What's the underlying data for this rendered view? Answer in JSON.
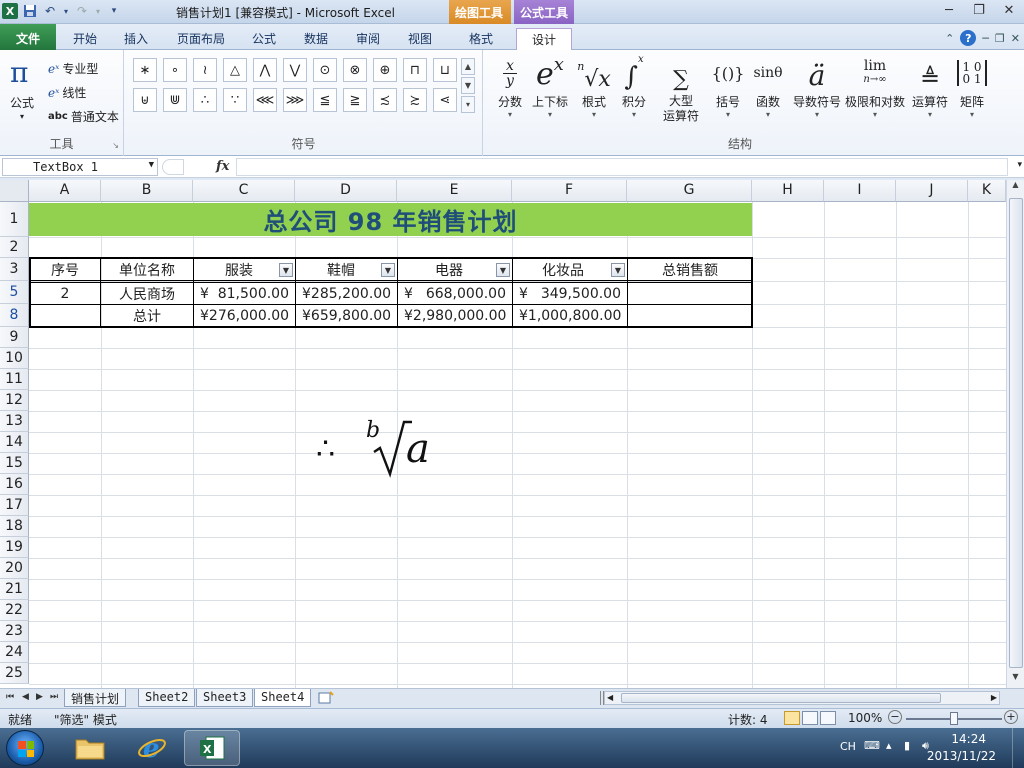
{
  "window": {
    "title": "销售计划1  [兼容模式]  -  Microsoft Excel",
    "context_tab_drawing": "绘图工具",
    "context_tab_equation": "公式工具"
  },
  "tabs": [
    "文件",
    "开始",
    "插入",
    "页面布局",
    "公式",
    "数据",
    "审阅",
    "视图",
    "格式",
    "设计"
  ],
  "active_tab": "设计",
  "ribbon": {
    "tools_group": {
      "equation_label": "公式",
      "professional": "专业型",
      "linear": "线性",
      "normal_text": "普通文本",
      "normal_text_prefix": "abc",
      "group_label": "工具"
    },
    "symbols_group": {
      "row1": [
        "∗",
        "∘",
        "≀",
        "△",
        "⋀",
        "⋁",
        "⊙",
        "⊗",
        "⊕",
        "⊓",
        "⊔"
      ],
      "row2": [
        "⊎",
        "⋓",
        "∴",
        "∵",
        "⋘",
        "⋙",
        "≦",
        "≧",
        "≾",
        "≿",
        "⋖"
      ],
      "group_label": "符号"
    },
    "structures_group": {
      "items": [
        {
          "label": "分数",
          "glyph": "x/y"
        },
        {
          "label": "上下标",
          "glyph": "eˣ"
        },
        {
          "label": "根式",
          "glyph": "ⁿ√x"
        },
        {
          "label": "积分",
          "glyph": "∫"
        },
        {
          "label": "大型\n运算符",
          "glyph": "∑"
        },
        {
          "label": "括号",
          "glyph": "{()}"
        },
        {
          "label": "函数",
          "glyph": "sinθ"
        },
        {
          "label": "导数符号",
          "glyph": "ä"
        },
        {
          "label": "极限和对数",
          "glyph": "lim"
        },
        {
          "label": "运算符",
          "glyph": "≜"
        },
        {
          "label": "矩阵",
          "glyph": "[10 01]"
        }
      ],
      "group_label": "结构"
    }
  },
  "formula_bar": {
    "name_box": "TextBox 1",
    "fx": "fx",
    "value": ""
  },
  "columns": [
    "A",
    "B",
    "C",
    "D",
    "E",
    "F",
    "G",
    "H",
    "I",
    "J",
    "K"
  ],
  "rows": [
    "1",
    "2",
    "3",
    "5",
    "8",
    "9",
    "10",
    "11",
    "12",
    "13",
    "14",
    "15",
    "16",
    "17",
    "18",
    "19",
    "20",
    "21",
    "22",
    "23",
    "24",
    "25"
  ],
  "sheet": {
    "title": "总公司  98  年销售计划",
    "headers": [
      "序号",
      "单位名称",
      "服装",
      "鞋帽",
      "电器",
      "化妆品",
      "总销售额"
    ],
    "row5": {
      "seq": "2",
      "unit": "人民商场",
      "c": "81,500.00",
      "d": "285,200.00",
      "e": "668,000.00",
      "f": "349,500.00",
      "g": ""
    },
    "row8": {
      "seq": "",
      "unit": "总计",
      "c": "276,000.00",
      "d": "659,800.00",
      "e": "2,980,000.00",
      "f": "1,000,800.00",
      "g": ""
    },
    "currency": "¥"
  },
  "equation": {
    "therefore": "∴",
    "index": "b",
    "radicand": "a"
  },
  "sheet_tabs": [
    "销售计划",
    "Sheet2",
    "Sheet3",
    "Sheet4"
  ],
  "active_sheet": "Sheet4",
  "status": {
    "ready": "就绪",
    "mode": "\"筛选\" 模式",
    "count": "计数: 4",
    "zoom": "100%"
  },
  "taskbar": {
    "lang": "CH",
    "time": "14:24",
    "date": "2013/11/22"
  },
  "colors": {
    "title_fill": "#92d050",
    "title_text": "#1f4e79",
    "file_tab": "#2f8a4a",
    "drawing_context": "#e39a3b",
    "equation_context": "#9b75cf"
  }
}
